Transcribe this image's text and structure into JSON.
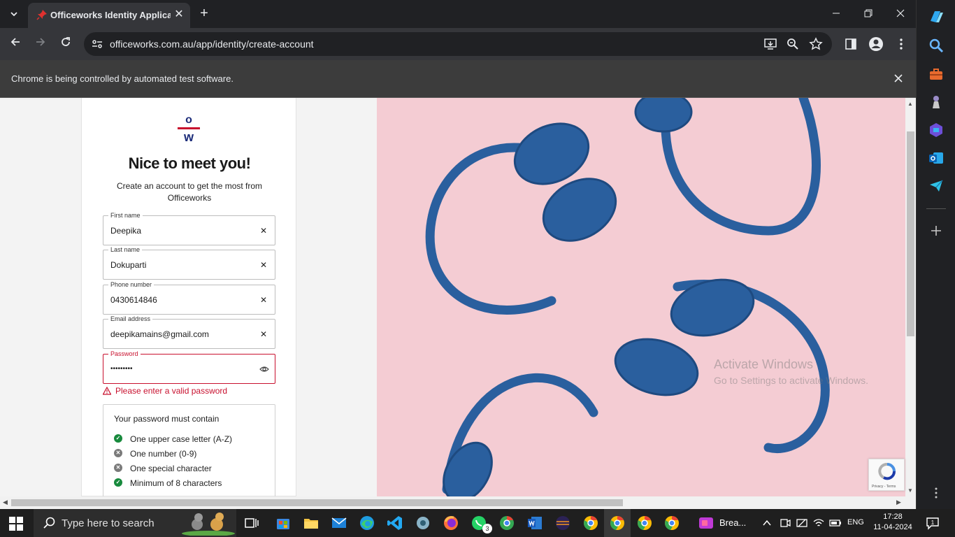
{
  "browser": {
    "tab_title": "Officeworks Identity Application",
    "new_tab_glyph": "+",
    "url": "officeworks.com.au/app/identity/create-account",
    "infobar_text": "Chrome is being controlled by automated test software."
  },
  "form": {
    "logo_letters": {
      "top": "o",
      "bottom": "w"
    },
    "heading": "Nice to meet you!",
    "subtitle": "Create an account to get the most from Officeworks",
    "fields": [
      {
        "label": "First name",
        "value": "Deepika"
      },
      {
        "label": "Last name",
        "value": "Dokuparti"
      },
      {
        "label": "Phone number",
        "value": "0430614846"
      },
      {
        "label": "Email address",
        "value": "deepikamains@gmail.com"
      },
      {
        "label": "Password",
        "value": "•••••••••",
        "state": "error"
      }
    ],
    "password_error": "Please enter a valid password",
    "rules_title": "Your password must contain",
    "rules": [
      {
        "text": "One upper case letter (A-Z)",
        "met": true
      },
      {
        "text": "One number (0-9)",
        "met": false
      },
      {
        "text": "One special character",
        "met": false
      },
      {
        "text": "Minimum of 8 characters",
        "met": true
      }
    ]
  },
  "overlay": {
    "watermark_title": "Activate Windows",
    "watermark_subtitle": "Go to Settings to activate Windows.",
    "recaptcha_links": "Privacy - Terms"
  },
  "taskbar": {
    "search_placeholder": "Type here to search",
    "running_app_label": "Brea...",
    "whatsapp_badge": "3",
    "language": "ENG",
    "time": "17:28",
    "date": "11-04-2024"
  },
  "colors": {
    "accent_red": "#c8102e",
    "brand_blue": "#1d2d7a",
    "success_green": "#188a3d",
    "hero_pink": "#f4ccd3",
    "headphone_blue": "#2a5f9e"
  }
}
